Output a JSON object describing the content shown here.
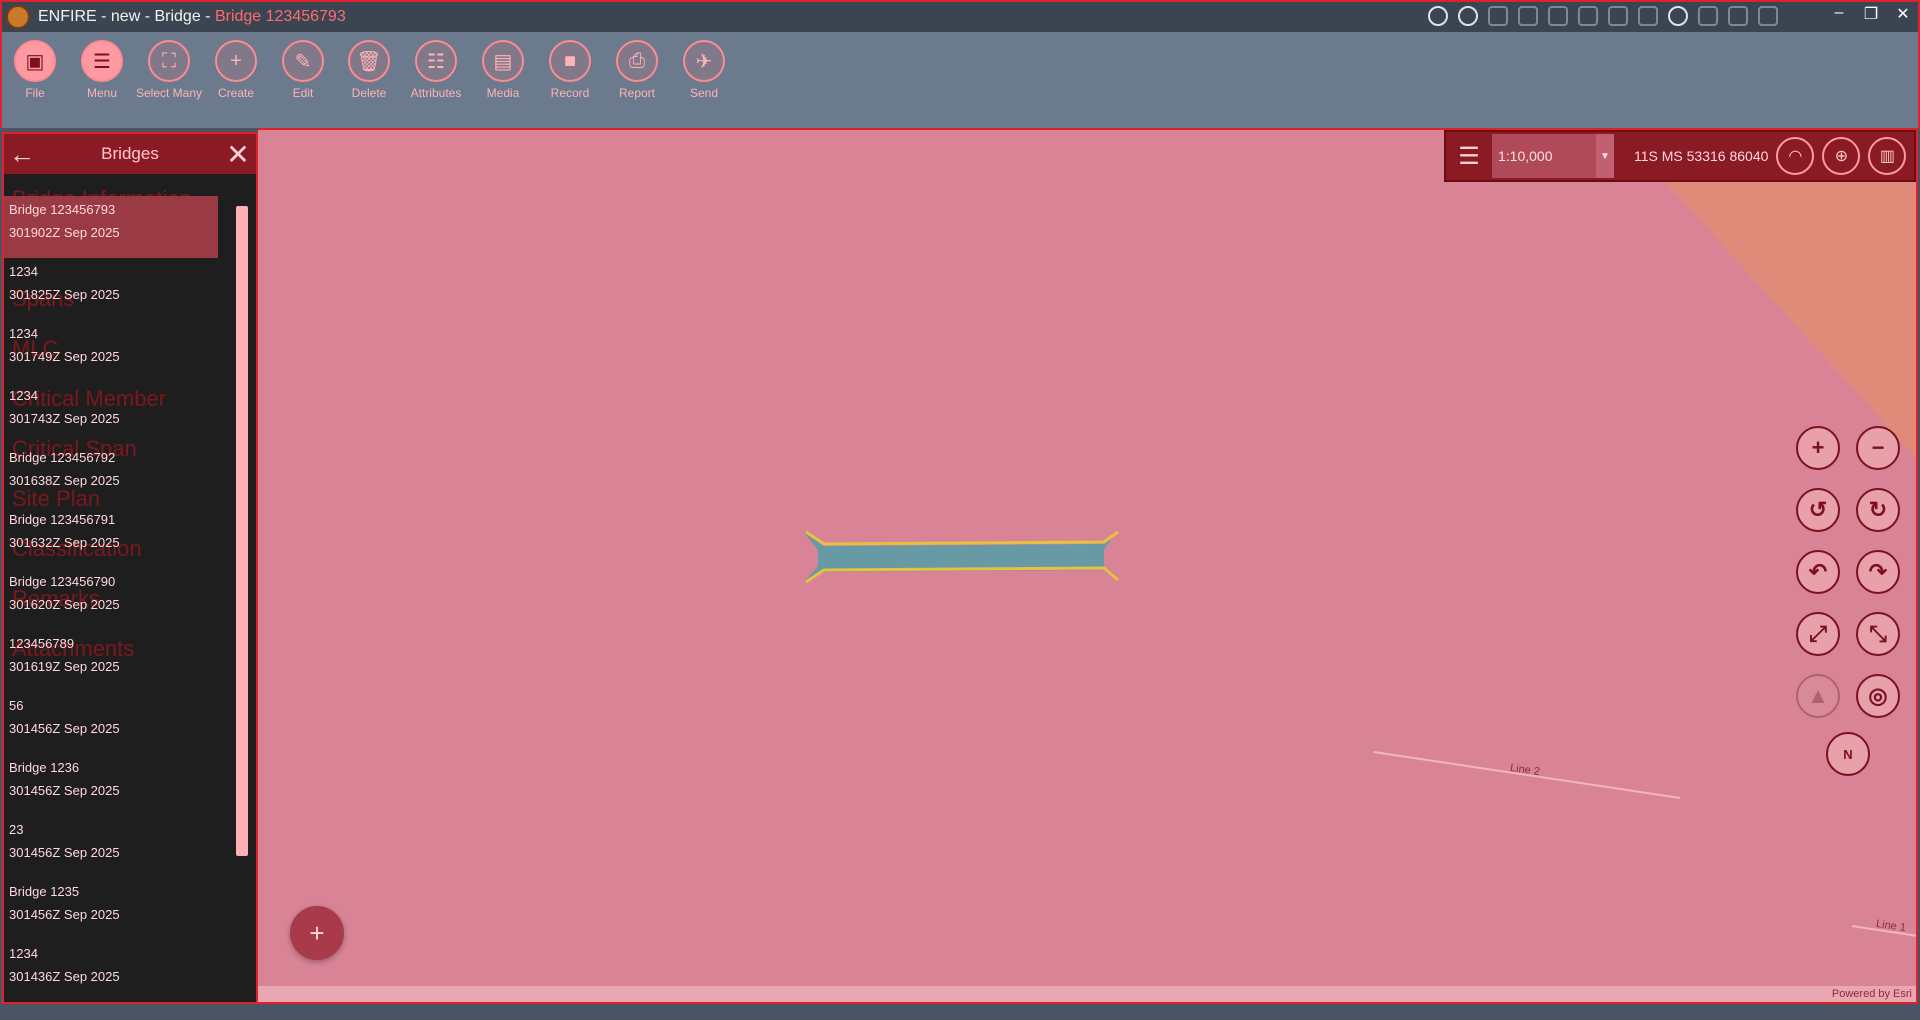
{
  "titlebar": {
    "app_name": "ENFIRE - new - Bridge - ",
    "doc_name": "Bridge 123456793",
    "icons": [
      "info-icon",
      "refresh-icon",
      "satellite-icon",
      "stack-icon",
      "layers-icon",
      "binoculars-icon",
      "cube-icon",
      "network-icon",
      "video-icon",
      "microphone-icon",
      "antenna-icon",
      "cloud-icon"
    ],
    "controls": {
      "minimize": "–",
      "restore": "❐",
      "close": "✕"
    }
  },
  "toolbar": {
    "items": [
      {
        "label": "File",
        "icon": "folder-icon",
        "glyph": "▣"
      },
      {
        "label": "Menu",
        "icon": "hamburger-icon",
        "glyph": "☰"
      },
      {
        "label": "Select Many",
        "icon": "select-many-icon",
        "glyph": "⛶"
      },
      {
        "label": "Create",
        "icon": "plus-icon",
        "glyph": "+"
      },
      {
        "label": "Edit",
        "icon": "pin-edit-icon",
        "glyph": "✎"
      },
      {
        "label": "Delete",
        "icon": "trash-icon",
        "glyph": "🗑"
      },
      {
        "label": "Attributes",
        "icon": "list-icon",
        "glyph": "☷"
      },
      {
        "label": "Media",
        "icon": "image-icon",
        "glyph": "▤"
      },
      {
        "label": "Record",
        "icon": "camera-icon",
        "glyph": "■"
      },
      {
        "label": "Report",
        "icon": "printer-icon",
        "glyph": "⎙"
      },
      {
        "label": "Send",
        "icon": "send-icon",
        "glyph": "✈"
      }
    ]
  },
  "panel": {
    "title": "Bridges",
    "ghost_text": [
      "Bridge Information",
      "Abutments",
      "Spans",
      "MLC",
      "Critical Member",
      "Critical Span",
      "Site Plan",
      "Classification",
      "Remarks",
      "Attachments"
    ],
    "items": [
      {
        "name": "Bridge 123456793",
        "time": "301902Z Sep 2025",
        "selected": true
      },
      {
        "name": "1234",
        "time": "301825Z Sep 2025"
      },
      {
        "name": "1234",
        "time": "301749Z Sep 2025"
      },
      {
        "name": "1234",
        "time": "301743Z Sep 2025"
      },
      {
        "name": "Bridge 123456792",
        "time": "301638Z Sep 2025"
      },
      {
        "name": "Bridge 123456791",
        "time": "301632Z Sep 2025"
      },
      {
        "name": "Bridge 123456790",
        "time": "301620Z Sep 2025"
      },
      {
        "name": "123456789",
        "time": "301619Z Sep 2025"
      },
      {
        "name": "56",
        "time": "301456Z Sep 2025"
      },
      {
        "name": "Bridge 1236",
        "time": "301456Z Sep 2025"
      },
      {
        "name": "23",
        "time": "301456Z Sep 2025"
      },
      {
        "name": "Bridge 1235",
        "time": "301456Z Sep 2025"
      },
      {
        "name": "1234",
        "time": "301436Z Sep 2025"
      }
    ]
  },
  "map": {
    "scale": "1:10,000",
    "coordinate": "11S MS 53316 86040",
    "line_labels": [
      "Line 2",
      "Line 1"
    ],
    "attribution": "Powered by Esri",
    "colors": {
      "background": "#d98496",
      "accent": "#8a1a24",
      "orange_region": "#e08a7a",
      "bridge_outline": "#e8c040",
      "bridge_fill": "#4aa0a8"
    }
  }
}
